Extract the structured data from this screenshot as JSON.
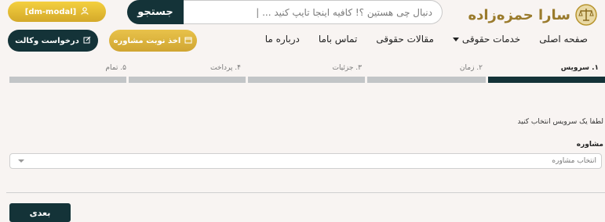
{
  "brand": {
    "name": "سارا حمزه‌زاده"
  },
  "search": {
    "placeholder": "دنبال چی هستین ؟! کافیه اینجا تایپ کنید ... |",
    "button_label": "جستجو"
  },
  "login": {
    "label": "[dm-modal]"
  },
  "nav": {
    "items": [
      {
        "label": "صفحه اصلی"
      },
      {
        "label": "خدمات حقوقی"
      },
      {
        "label": "مقالات حقوقی"
      },
      {
        "label": "تماس باما"
      },
      {
        "label": "درباره ما"
      }
    ]
  },
  "actions": {
    "consult_label": "اخذ نوبت مشاوره",
    "lawyer_label": "درخواست وکالت"
  },
  "steps": [
    {
      "label": "۱. سرویس",
      "active": true
    },
    {
      "label": "۲. زمان",
      "active": false
    },
    {
      "label": "۳. جزئیات",
      "active": false
    },
    {
      "label": "۴. پرداخت",
      "active": false
    },
    {
      "label": "۵. تمام",
      "active": false
    }
  ],
  "form": {
    "instruction": "لطفا یک سرویس انتخاب کنید",
    "field_label": "مشاوره",
    "select_placeholder": "انتخاب مشاوره"
  },
  "footer": {
    "next_label": "بعدی"
  },
  "colors": {
    "primary": "#143338",
    "accent": "#d4a92a",
    "background": "#f8f4f2"
  }
}
